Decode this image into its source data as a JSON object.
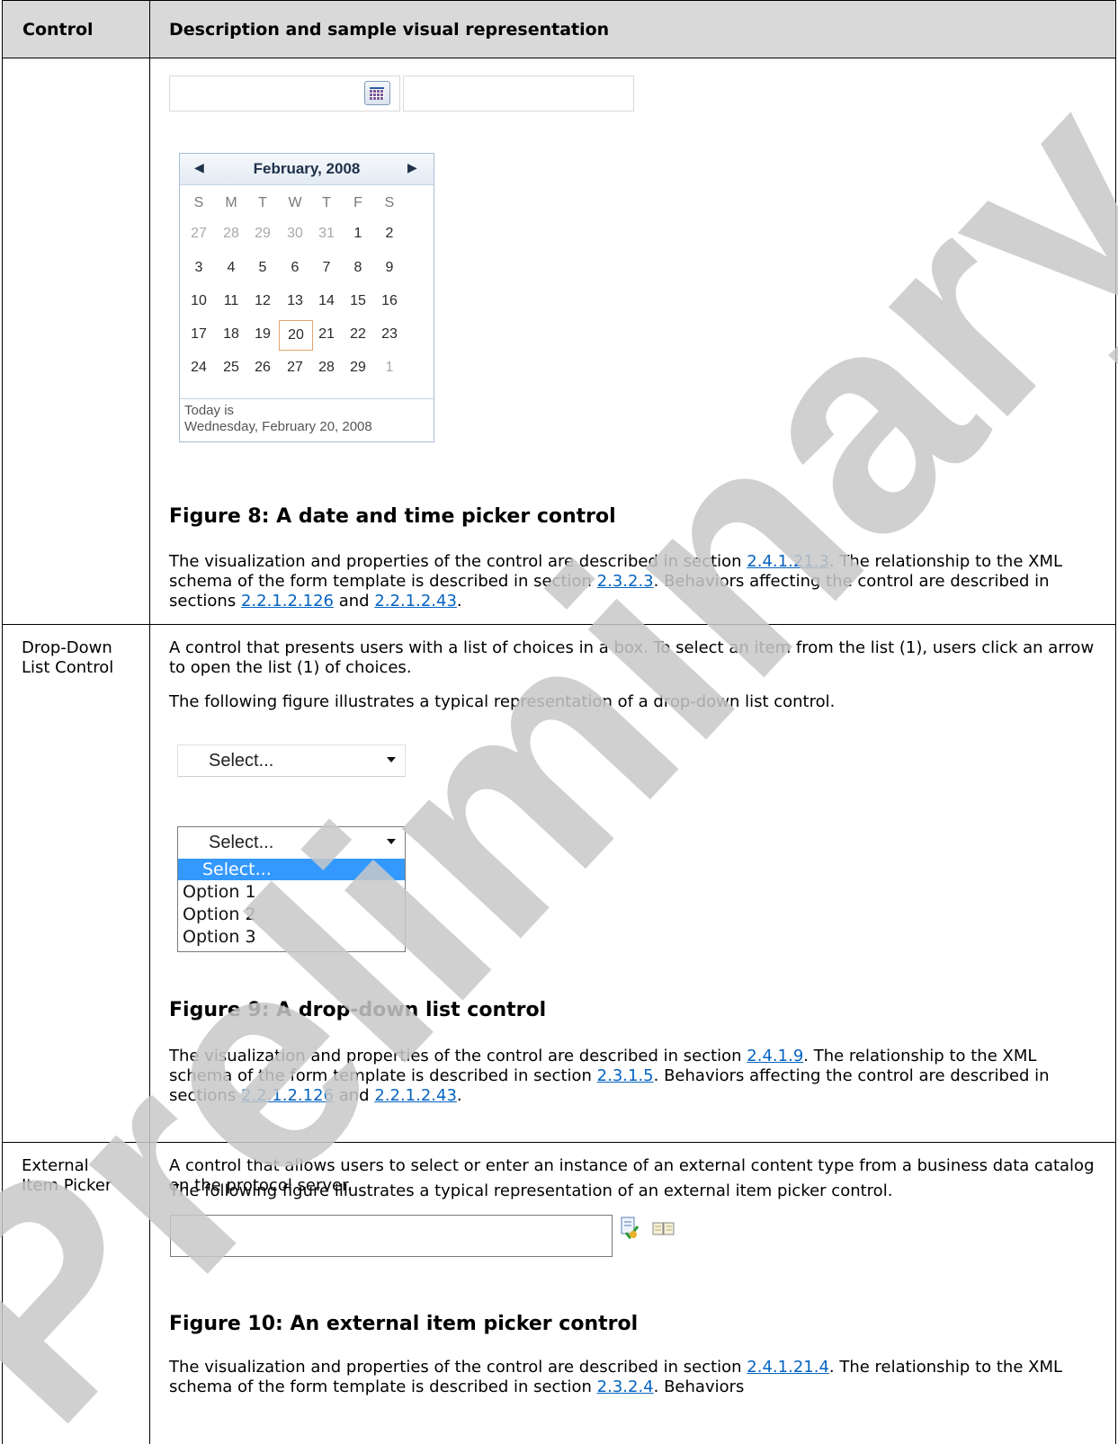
{
  "table": {
    "headers": [
      "Control",
      "Description and sample visual representation"
    ]
  },
  "date_picker": {
    "calendar": {
      "month_title": "February, 2008",
      "prev_symbol": "◀",
      "next_symbol": "▶",
      "weekdays": [
        "S",
        "M",
        "T",
        "W",
        "T",
        "F",
        "S"
      ],
      "weeks": [
        [
          "27",
          "28",
          "29",
          "30",
          "31",
          "1",
          "2"
        ],
        [
          "3",
          "4",
          "5",
          "6",
          "7",
          "8",
          "9"
        ],
        [
          "10",
          "11",
          "12",
          "13",
          "14",
          "15",
          "16"
        ],
        [
          "17",
          "18",
          "19",
          "20",
          "21",
          "22",
          "23"
        ],
        [
          "24",
          "25",
          "26",
          "27",
          "28",
          "29",
          "1"
        ]
      ],
      "selected_day": "20",
      "footer_line1": "Today is",
      "footer_line2": "Wednesday, February 20, 2008"
    },
    "caption": "Figure 8: A date and time picker control",
    "para": {
      "t1": "The visualization and properties of the control are described in section ",
      "l1": "2.4.1.21.3",
      "t2": ". The relationship to the XML schema of the form template is described in section ",
      "l2": "2.3.2.3",
      "t3": ". Behaviors affecting the control are described in sections ",
      "l3": "2.2.1.2.126",
      "t4": " and ",
      "l4": "2.2.1.2.43",
      "t5": "."
    }
  },
  "drop_down": {
    "name_line1": "Drop-Down",
    "name_line2": "List Control",
    "description": "A control that presents users with a list of choices in a box. To select an item from the list (1), users click an arrow to open the list (1) of choices.",
    "intro": "The following figure illustrates a typical representation of a drop-down list control.",
    "closed_value": "Select...",
    "open_value": "Select...",
    "options": [
      "Select...",
      "Option 1",
      "Option 2",
      "Option 3"
    ],
    "caption": "Figure 9: A drop-down list control",
    "para": {
      "t1": "The visualization and properties of the control are described in section ",
      "l1": "2.4.1.9",
      "t2": ". The relationship to the XML schema of the form template is described in section ",
      "l2": "2.3.1.5",
      "t3": ". Behaviors affecting the control are described in sections ",
      "l3": "2.2.1.2.126",
      "t4": " and ",
      "l4": "2.2.1.2.43",
      "t5": "."
    }
  },
  "external_picker": {
    "name_line1": "External",
    "name_line2": "Item Picker",
    "description": "A control that allows users to select or enter an instance of an external content type from a business data catalog on the protocol server.",
    "intro": "The following figure illustrates a typical representation of an external item picker control.",
    "caption": "Figure 10: An external item picker control",
    "para": {
      "t1": "The visualization and properties of the control are described in section ",
      "l1": "2.4.1.21.4",
      "t2": ". The relationship to the XML schema of the form template is described in section ",
      "l2": "2.3.2.4",
      "t3": ". Behaviors"
    }
  },
  "watermark": {
    "text": "Preliminary",
    "color": "#c8c8c8"
  }
}
